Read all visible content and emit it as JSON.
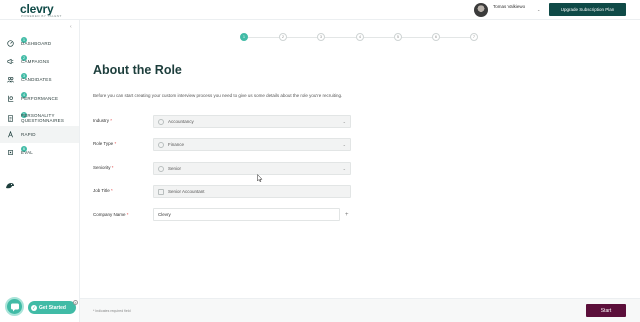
{
  "brand": {
    "logo": "clevry",
    "tagline": "POWERED BY TALENT"
  },
  "header": {
    "user_name": "Tomas Valkiewo",
    "upgrade_label": "Upgrade Subscription Plan"
  },
  "sidebar": {
    "items": [
      {
        "label": "DASHBOARD",
        "badge": "1",
        "icon": "dashboard-icon"
      },
      {
        "label": "CAMPAIGNS",
        "badge": "2",
        "icon": "megaphone-icon"
      },
      {
        "label": "CANDIDATES",
        "badge": "3",
        "icon": "people-icon"
      },
      {
        "label": "PERFORMANCE",
        "badge": "4",
        "icon": "chart-icon"
      },
      {
        "label": "PERSONALITY QUESTIONNAIRES",
        "badge": "5",
        "icon": "questionnaire-icon"
      },
      {
        "label": "RAPID",
        "badge": "",
        "icon": "rapid-icon",
        "active": true
      },
      {
        "label": "EVAL",
        "badge": "6",
        "icon": "eval-icon"
      }
    ]
  },
  "stepper": {
    "steps": [
      "1",
      "2",
      "3",
      "4",
      "5",
      "6",
      "7"
    ],
    "current": 1
  },
  "main": {
    "title": "About the Role",
    "description": "Before you can start creating your custom interview process you need to give us some details about the role you're recruiting.",
    "fields": [
      {
        "label": "Industry",
        "value": "Accountancy",
        "type": "select"
      },
      {
        "label": "Role Type",
        "value": "Finance",
        "type": "select"
      },
      {
        "label": "Seniority",
        "value": "Senior",
        "type": "select"
      },
      {
        "label": "Job Title",
        "value": "Senior Accountant",
        "type": "text"
      },
      {
        "label": "Company Name",
        "value": "Clevry",
        "type": "text"
      }
    ],
    "required_marker": "*",
    "add_symbol": "+"
  },
  "footer": {
    "required_note": "* Indicates required field",
    "start_label": "Start"
  },
  "widgets": {
    "get_started_label": "Get Started"
  },
  "colors": {
    "brand": "#0f4a47",
    "accent": "#41bba6",
    "start": "#5b0f3a"
  }
}
